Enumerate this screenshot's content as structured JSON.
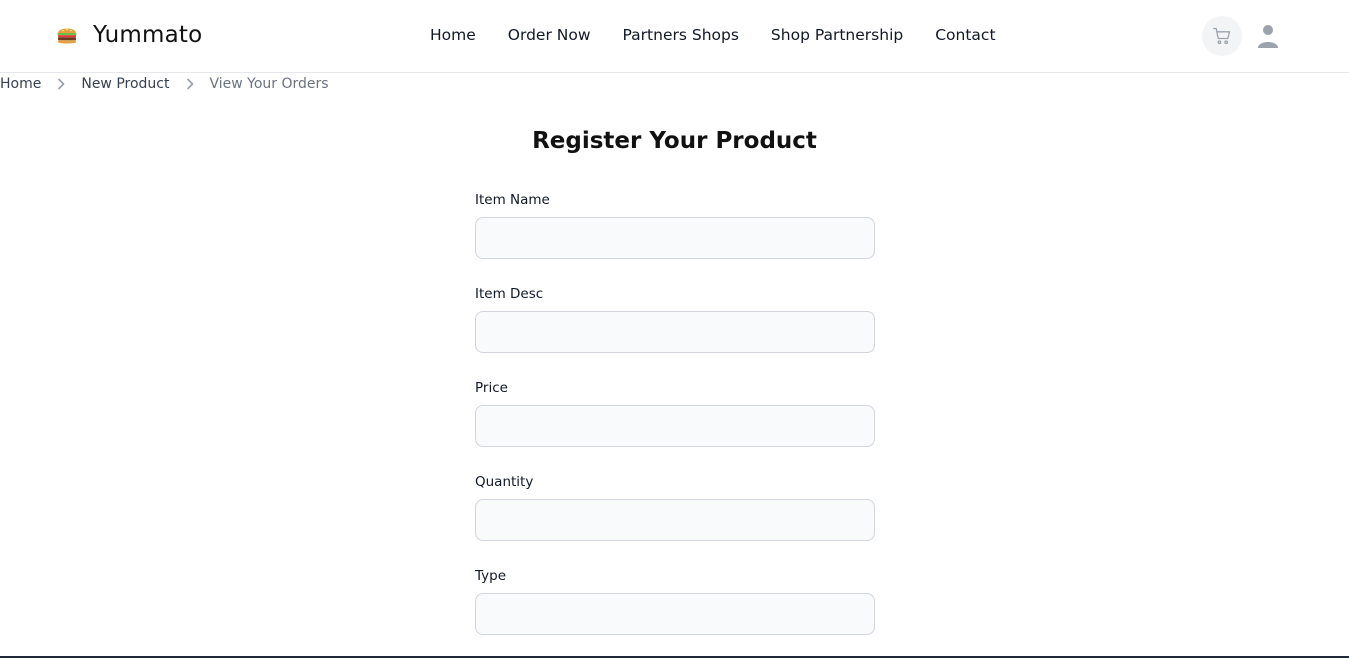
{
  "brand": {
    "name": "Yummato",
    "logo_icon": "burger-icon"
  },
  "nav": {
    "links": [
      "Home",
      "Order Now",
      "Partners Shops",
      "Shop Partnership",
      "Contact"
    ]
  },
  "header_actions": {
    "cart_icon": "cart-icon",
    "user_icon": "user-icon"
  },
  "breadcrumb": {
    "items": [
      "Home",
      "New Product",
      "View Your Orders"
    ],
    "separator_icon": "chevron-right-icon"
  },
  "page": {
    "title": "Register Your Product"
  },
  "form": {
    "fields": [
      {
        "label": "Item Name",
        "value": "",
        "placeholder": ""
      },
      {
        "label": "Item Desc",
        "value": "",
        "placeholder": ""
      },
      {
        "label": "Price",
        "value": "",
        "placeholder": ""
      },
      {
        "label": "Quantity",
        "value": "",
        "placeholder": ""
      },
      {
        "label": "Type",
        "value": "",
        "placeholder": ""
      }
    ]
  },
  "colors": {
    "border": "#e5e7eb",
    "input_bg": "#f9fafb",
    "input_border": "#d1d5db",
    "muted_text": "#6b7280",
    "cart_bg": "#f3f4f6",
    "icon_gray": "#9ca3af"
  }
}
